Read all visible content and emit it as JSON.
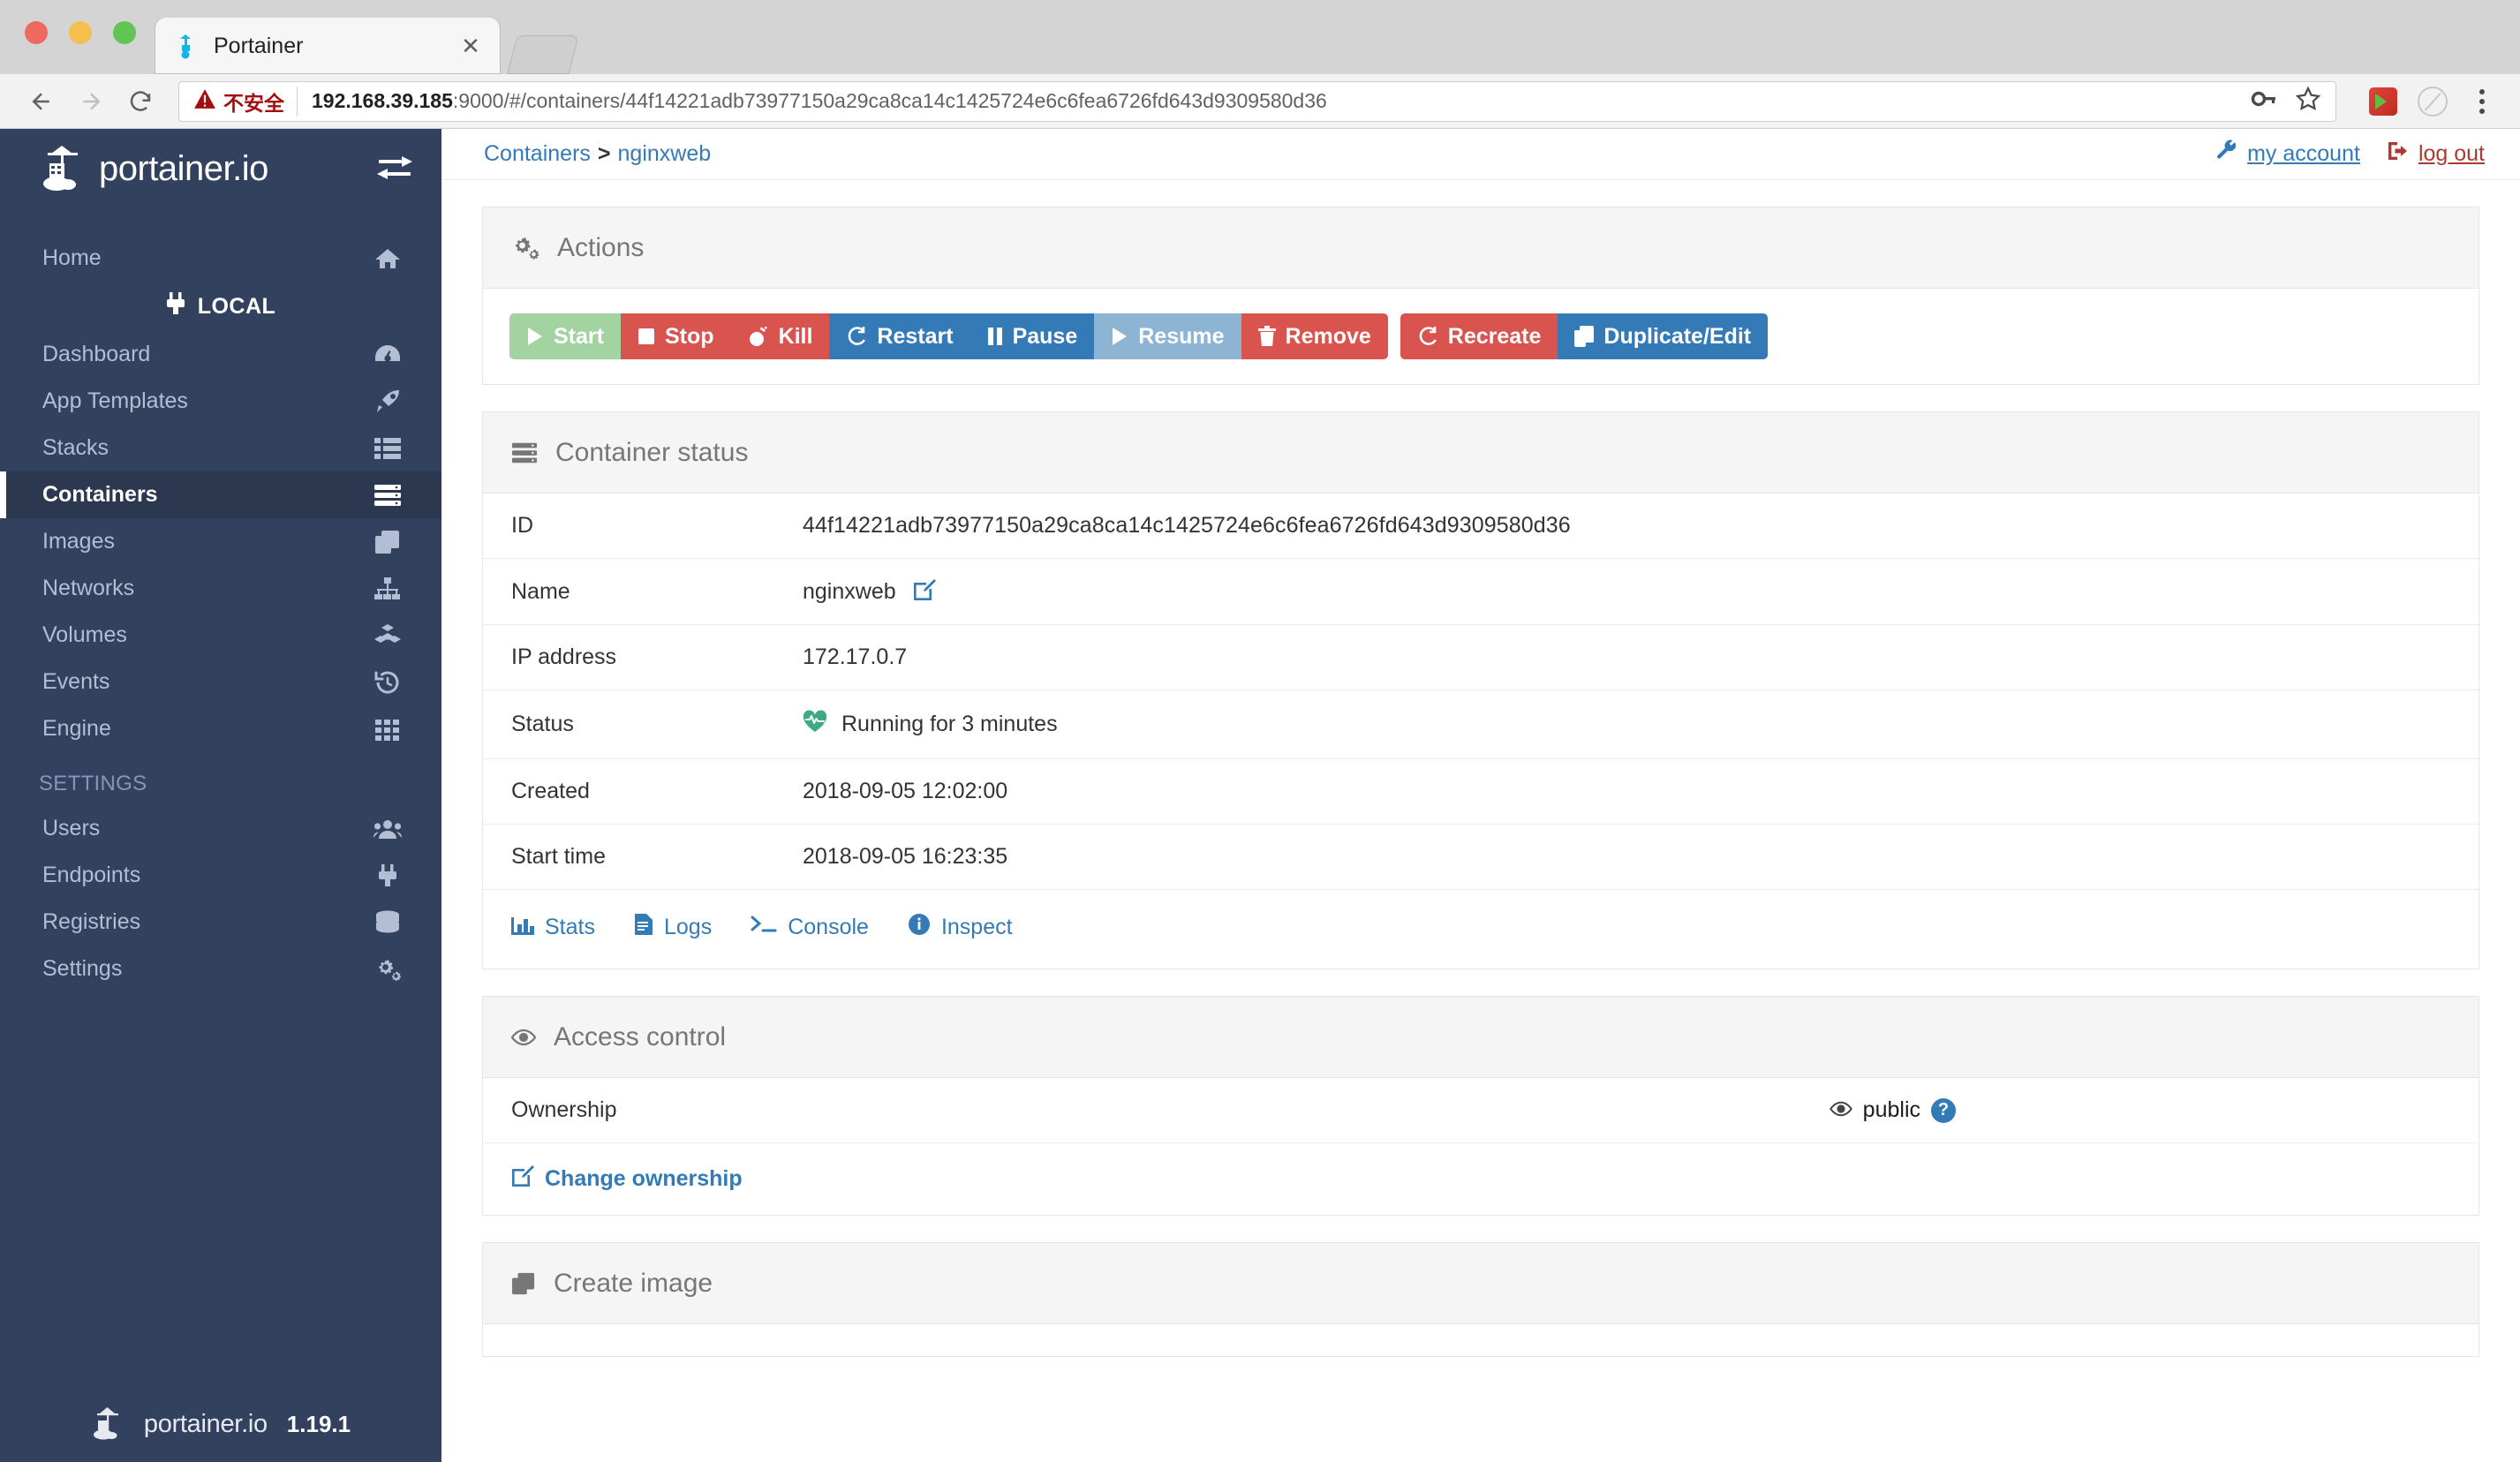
{
  "browser": {
    "tab": {
      "title": "Portainer",
      "favicon": "portainer-whale-icon",
      "close_label": "✕"
    },
    "toolbar": {
      "back_icon": "back-arrow-icon",
      "forward_icon": "forward-arrow-icon",
      "reload_icon": "reload-icon",
      "security_label": "不安全",
      "security_icon": "warning-triangle-icon",
      "url_host": "192.168.39.185",
      "url_rest": ":9000/#/containers/44f14221adb73977150a29ca8ca14c1425724e6c6fea6726fd643d9309580d36",
      "key_icon": "key-icon",
      "bookmark_icon": "star-icon",
      "extension_1": "flash-player-extension-icon",
      "extension_2": "grayed-extension-icon",
      "menu_icon": "three-dot-menu-icon"
    }
  },
  "sidebar": {
    "brand": "portainer.io",
    "brand_logo_icon": "portainer-crane-logo",
    "toggle_icon": "collapse-sidebar-icon",
    "home": {
      "label": "Home",
      "icon": "home-icon"
    },
    "endpoint": {
      "label": "LOCAL",
      "icon": "plug-icon"
    },
    "items": [
      {
        "label": "Dashboard",
        "icon": "dashboard-gauge-icon",
        "active": false
      },
      {
        "label": "App Templates",
        "icon": "rocket-icon",
        "active": false
      },
      {
        "label": "Stacks",
        "icon": "list-icon",
        "active": false
      },
      {
        "label": "Containers",
        "icon": "server-stack-icon",
        "active": true
      },
      {
        "label": "Images",
        "icon": "layers-icon",
        "active": false
      },
      {
        "label": "Networks",
        "icon": "sitemap-icon",
        "active": false
      },
      {
        "label": "Volumes",
        "icon": "cubes-icon",
        "active": false
      },
      {
        "label": "Events",
        "icon": "history-clock-icon",
        "active": false
      },
      {
        "label": "Engine",
        "icon": "grid-icon",
        "active": false
      }
    ],
    "section_label": "SETTINGS",
    "settings_items": [
      {
        "label": "Users",
        "icon": "users-icon"
      },
      {
        "label": "Endpoints",
        "icon": "plug-icon"
      },
      {
        "label": "Registries",
        "icon": "database-icon"
      },
      {
        "label": "Settings",
        "icon": "gears-icon"
      }
    ],
    "footer": {
      "brand": "portainer.io",
      "version": "1.19.1",
      "logo_icon": "portainer-crane-logo"
    }
  },
  "topbar": {
    "breadcrumb_root": "Containers",
    "breadcrumb_sep": ">",
    "breadcrumb_current": "nginxweb",
    "my_account": "my account",
    "my_account_icon": "wrench-icon",
    "log_out": "log out",
    "log_out_icon": "sign-out-icon"
  },
  "actions_panel": {
    "title": "Actions",
    "icon": "gears-icon",
    "buttons": [
      {
        "label": "Start",
        "icon": "play-icon",
        "style": "success-disabled"
      },
      {
        "label": "Stop",
        "icon": "stop-icon",
        "style": "danger"
      },
      {
        "label": "Kill",
        "icon": "bomb-icon",
        "style": "danger"
      },
      {
        "label": "Restart",
        "icon": "refresh-icon",
        "style": "primary"
      },
      {
        "label": "Pause",
        "icon": "pause-icon",
        "style": "primary"
      },
      {
        "label": "Resume",
        "icon": "play-icon",
        "style": "primary-disabled"
      },
      {
        "label": "Remove",
        "icon": "trash-icon",
        "style": "danger"
      },
      {
        "label": "Recreate",
        "icon": "refresh-icon",
        "style": "danger",
        "group": 2
      },
      {
        "label": "Duplicate/Edit",
        "icon": "copy-icon",
        "style": "primary",
        "group": 2
      }
    ],
    "colors": {
      "success_disabled": "#a3d3a0",
      "danger": "#d9534f",
      "primary": "#337ab7",
      "primary_disabled": "#8eb4d4"
    }
  },
  "container_status": {
    "title": "Container status",
    "icon": "server-stack-icon",
    "rows": [
      {
        "key": "ID",
        "value": "44f14221adb73977150a29ca8ca14c1425724e6c6fea6726fd643d9309580d36"
      },
      {
        "key": "Name",
        "value": "nginxweb"
      },
      {
        "key": "IP address",
        "value": "172.17.0.7"
      },
      {
        "key": "Status",
        "value": "Running for 3 minutes"
      },
      {
        "key": "Created",
        "value": "2018-09-05 12:02:00"
      },
      {
        "key": "Start time",
        "value": "2018-09-05 16:23:35"
      }
    ],
    "name_edit_icon": "edit-pencil-icon",
    "status_icon": "heartbeat-icon",
    "status_icon_color": "#3daa84",
    "links": [
      {
        "label": "Stats",
        "icon": "chart-bar-icon"
      },
      {
        "label": "Logs",
        "icon": "file-text-icon"
      },
      {
        "label": "Console",
        "icon": "terminal-icon"
      },
      {
        "label": "Inspect",
        "icon": "info-circle-icon"
      }
    ]
  },
  "access_control": {
    "title": "Access control",
    "icon": "eye-icon",
    "ownership_label": "Ownership",
    "ownership_value": "public",
    "ownership_icon": "eye-icon",
    "help_icon": "question-mark-icon",
    "change_link": "Change ownership",
    "change_icon": "edit-pencil-icon"
  },
  "create_image": {
    "title": "Create image",
    "icon": "layers-icon"
  }
}
